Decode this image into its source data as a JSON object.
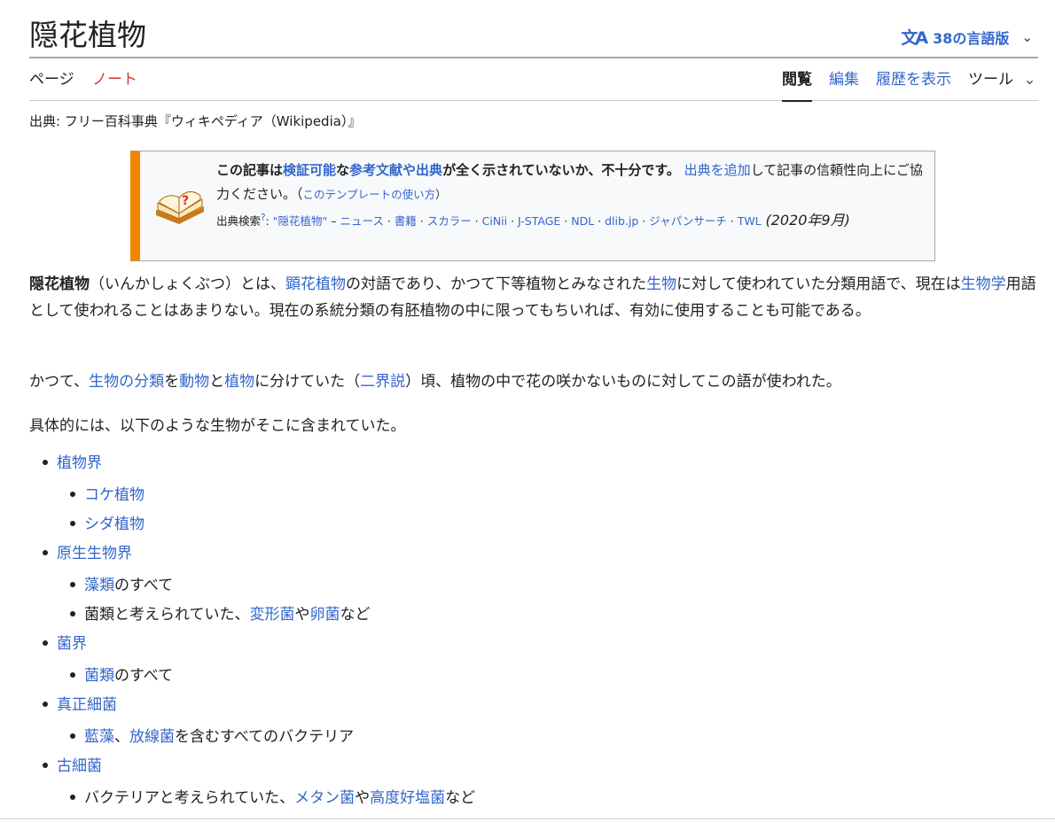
{
  "header": {
    "title": "隠花植物",
    "lang_label": "38の言語版",
    "lang_icon": "translate-icon"
  },
  "tabs": {
    "page": "ページ",
    "talk": "ノート",
    "read": "閲覧",
    "edit": "編集",
    "history": "履歴を表示",
    "tools": "ツール"
  },
  "from_text": "出典: フリー百科事典『ウィキペディア（Wikipedia）』",
  "ambox": {
    "icon": "book-question-icon",
    "t1": "この記事は",
    "l1": "検証可能",
    "t2": "な",
    "l2": "参考文献や出典",
    "t3": "が全く示されていないか、不十分です。",
    "l3": "出典を追加",
    "t4": "して記事の信頼性向上にご協力ください。（",
    "l4": "このテンプレートの使い方",
    "t5": "）",
    "search_label": "出典検索",
    "search_q": "?",
    "search_sep": ": ",
    "s_term": "\"隠花植物\"",
    "s_dash": " – ",
    "s_news": "ニュース",
    "s_books": "書籍",
    "s_scholar": "スカラー",
    "s_cinii": "CiNii",
    "s_jstage": "J-STAGE",
    "s_ndl": "NDL",
    "s_dlib": "dlib.jp",
    "s_japan": "ジャパンサーチ",
    "s_twl": "TWL",
    "dot": " · ",
    "date": "(2020年9月)"
  },
  "p1": {
    "bold": "隠花植物",
    "a": "（いんかしょくぶつ）とは、",
    "l1": "顕花植物",
    "b": "の対語であり、かつて下等植物とみなされた",
    "l2": "生物",
    "c": "に対して使われていた分類用語で、現在は",
    "l3": "生物学",
    "d": "用語として使われることはあまりない。現在の系統分類の有胚植物の中に限ってもちいれば、有効に使用することも可能である。"
  },
  "p2": {
    "a": "かつて、",
    "l1": "生物の分類",
    "b": "を",
    "l2": "動物",
    "c": "と",
    "l3": "植物",
    "d": "に分けていた（",
    "l4": "二界説",
    "e": "）頃、植物の中で花の咲かないものに対してこの語が使われた。"
  },
  "p3": "具体的には、以下のような生物がそこに含まれていた。",
  "list": {
    "plantae": "植物界",
    "moss": "コケ植物",
    "fern": "シダ植物",
    "protista": "原生生物界",
    "algae_link": "藻類",
    "all_suffix": "のすべて",
    "fungi_pre": "菌類と考えられていた、",
    "slime": "変形菌",
    "ya": "や",
    "oomycete": "卵菌",
    "nado": "など",
    "fungi_kingdom": "菌界",
    "fungi_link": "菌類",
    "eubacteria": "真正細菌",
    "cyano": "藍藻",
    "comma": "、",
    "actino": "放線菌",
    "bact_suffix": "を含むすべてのバクテリア",
    "archaea": "古細菌",
    "arch_pre": "バクテリアと考えられていた、",
    "methan": "メタン菌",
    "halo": "高度好塩菌"
  }
}
